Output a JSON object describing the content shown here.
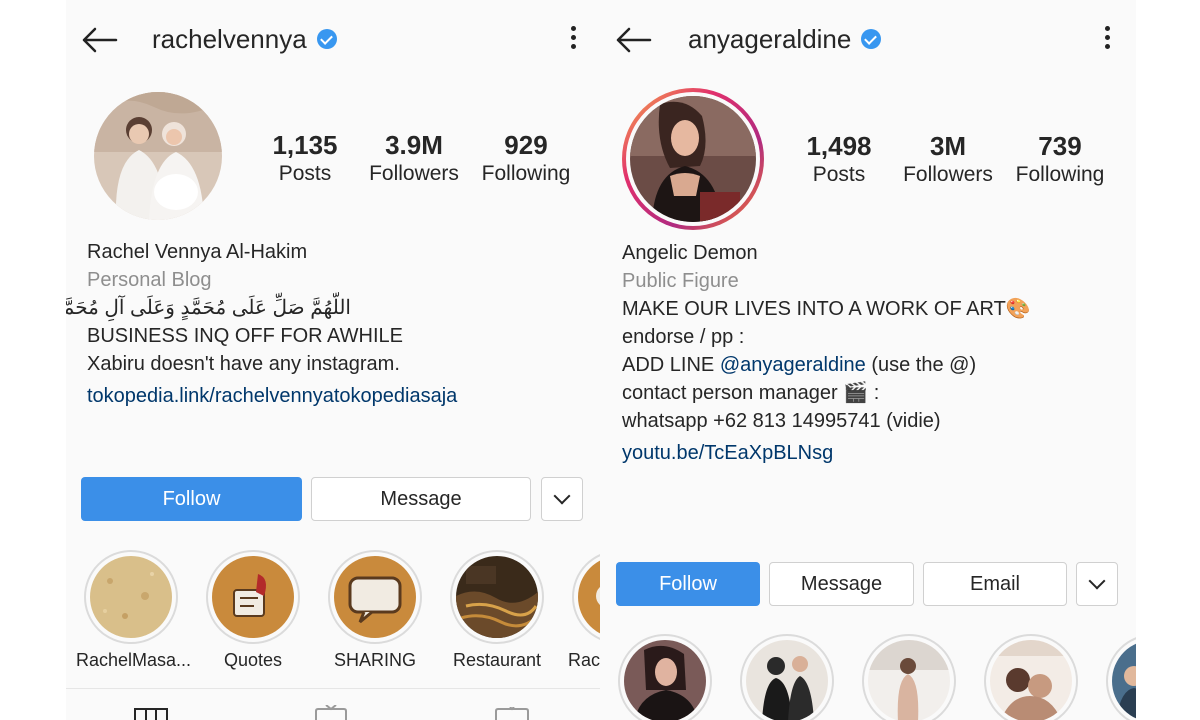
{
  "left": {
    "username": "rachelvennya",
    "stats": [
      {
        "num": "1,135",
        "label": "Posts"
      },
      {
        "num": "3.9M",
        "label": "Followers"
      },
      {
        "num": "929",
        "label": "Following"
      }
    ],
    "bio": {
      "name": "Rachel Vennya Al-Hakim",
      "category": "Personal Blog",
      "line1": "اللّهُمَّ صَلِّ عَلَى مُحَمَّدٍ وَعَلَى آلِ مُحَمَّدٍ",
      "line2": "BUSINESS INQ OFF FOR AWHILE",
      "line3": "Xabiru doesn't have any instagram.",
      "link": "tokopedia.link/rachelvennyatokopediasaja"
    },
    "buttons": {
      "follow": "Follow",
      "message": "Message"
    },
    "highlights": [
      "RachelMasa...",
      "Quotes",
      "SHARING",
      "Restaurant",
      "Rach"
    ]
  },
  "right": {
    "username": "anyageraldine",
    "stats": [
      {
        "num": "1,498",
        "label": "Posts"
      },
      {
        "num": "3M",
        "label": "Followers"
      },
      {
        "num": "739",
        "label": "Following"
      }
    ],
    "bio": {
      "name": "Angelic Demon",
      "category": "Public Figure",
      "line1": "MAKE OUR LIVES INTO A WORK OF ART🎨",
      "line2": "endorse / pp :",
      "line3_prefix": "ADD LINE ",
      "line3_mention": "@anyageraldine",
      "line3_suffix": " (use the @)",
      "line4": "contact person manager 🎬 :",
      "line5": "whatsapp +62 813 14995741 (vidie)",
      "link": "youtu.be/TcEaXpBLNsg"
    },
    "buttons": {
      "follow": "Follow",
      "message": "Message",
      "email": "Email"
    }
  },
  "colors": {
    "accent": "#3b8fe8",
    "verified": "#3897f0",
    "link": "#00376b",
    "muted": "#8e8e8e"
  }
}
